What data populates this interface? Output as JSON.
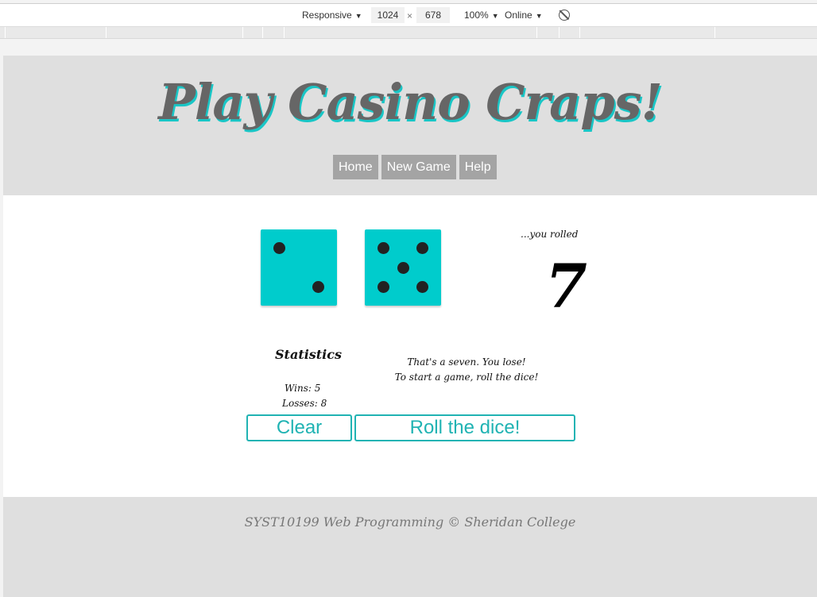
{
  "devtools": {
    "device": "Responsive",
    "width": "1024",
    "times": "×",
    "height": "678",
    "zoom": "100%",
    "network": "Online",
    "rotate_icon": "rotate-disabled-icon"
  },
  "header": {
    "title": "Play Casino Craps!",
    "nav": [
      "Home",
      "New Game",
      "Help"
    ]
  },
  "dice": {
    "die1": 2,
    "die2": 5,
    "die_color": "#00cccc"
  },
  "result": {
    "caption": "...you rolled",
    "total": "7"
  },
  "statistics": {
    "title": "Statistics",
    "wins": "Wins: 5",
    "losses": "Losses: 8"
  },
  "message": {
    "line1": "That's a seven. You lose!",
    "line2": "To start a game, roll the dice!"
  },
  "buttons": {
    "clear": "Clear",
    "roll": "Roll the dice!"
  },
  "footer": {
    "text": "SYST10199 Web Programming © Sheridan College"
  },
  "colors": {
    "accent": "#19c6c6",
    "header_bg": "#dfdfdf",
    "nav_bg": "#a4a4a4"
  }
}
